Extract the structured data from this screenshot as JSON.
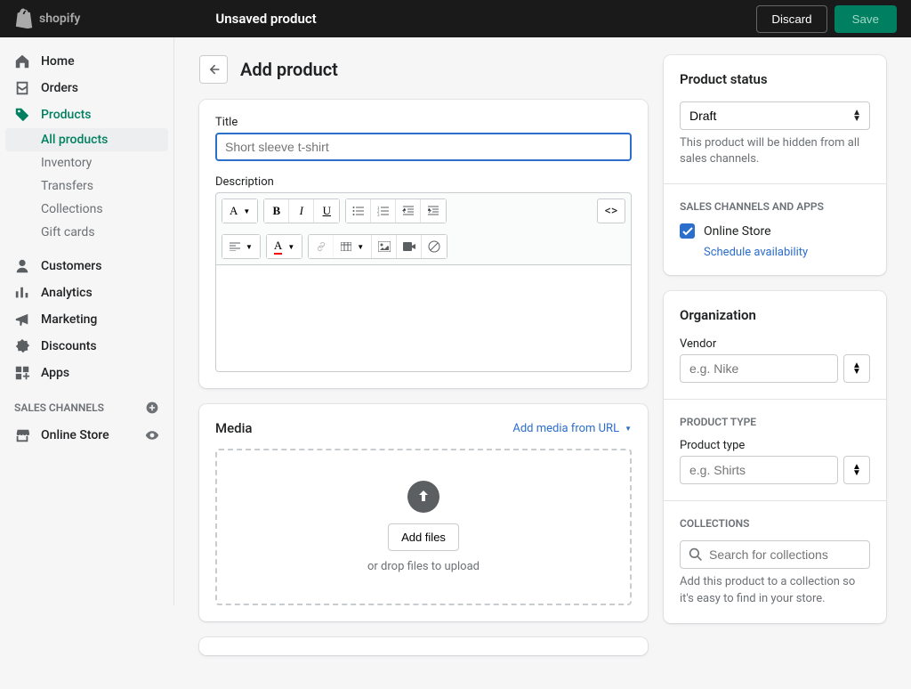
{
  "header": {
    "brand": "shopify",
    "title": "Unsaved product",
    "discard_label": "Discard",
    "save_label": "Save"
  },
  "nav": {
    "home": "Home",
    "orders": "Orders",
    "products": "Products",
    "all_products": "All products",
    "inventory": "Inventory",
    "transfers": "Transfers",
    "collections": "Collections",
    "gift_cards": "Gift cards",
    "customers": "Customers",
    "analytics": "Analytics",
    "marketing": "Marketing",
    "discounts": "Discounts",
    "apps": "Apps",
    "sales_channels": "SALES CHANNELS",
    "online_store": "Online Store"
  },
  "page": {
    "title": "Add product"
  },
  "title_field": {
    "label": "Title",
    "placeholder": "Short sleeve t-shirt"
  },
  "description_label": "Description",
  "media": {
    "title": "Media",
    "url_link": "Add media from URL",
    "add_files": "Add files",
    "drop_text": "or drop files to upload"
  },
  "status": {
    "title": "Product status",
    "value": "Draft",
    "help": "This product will be hidden from all sales channels.",
    "channels_heading": "SALES CHANNELS AND APPS",
    "online_store": "Online Store",
    "schedule": "Schedule availability"
  },
  "org": {
    "title": "Organization",
    "vendor_label": "Vendor",
    "vendor_placeholder": "e.g. Nike",
    "type_heading": "PRODUCT TYPE",
    "type_label": "Product type",
    "type_placeholder": "e.g. Shirts",
    "collections_heading": "COLLECTIONS",
    "collections_placeholder": "Search for collections",
    "collections_help": "Add this product to a collection so it's easy to find in your store."
  }
}
